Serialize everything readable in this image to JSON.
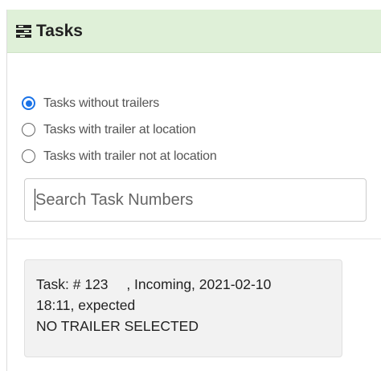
{
  "panel": {
    "title": "Tasks",
    "icon": "tasks-list-icon",
    "header_color": "#dff0d8",
    "accent_color": "#1a73e8"
  },
  "filters": [
    {
      "label": "Tasks without trailers",
      "checked": true
    },
    {
      "label": "Tasks with trailer at location",
      "checked": false
    },
    {
      "label": "Tasks with trailer not at location",
      "checked": false
    }
  ],
  "search": {
    "placeholder": "Search Task Numbers",
    "value": ""
  },
  "task_card": {
    "prefix": "Task: #",
    "number": "123",
    "details": ", Incoming, 2021-02-10",
    "time_status": "18:11, expected",
    "trailer_status": "NO TRAILER SELECTED"
  }
}
